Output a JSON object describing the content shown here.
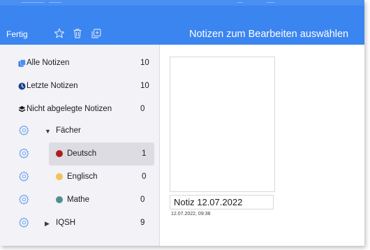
{
  "toolbar": {
    "done_label": "Fertig",
    "title": "Notizen zum Bearbeiten auswählen",
    "icons": [
      "star-icon",
      "trash-icon",
      "duplicate-icon"
    ],
    "accent_color": "#3b85f0"
  },
  "sidebar": {
    "items": [
      {
        "label": "Alle Notizen",
        "count": "10",
        "icon": "notes-stack-icon"
      },
      {
        "label": "Letzte Notizen",
        "count": "10",
        "icon": "clock-icon"
      },
      {
        "label": "Nicht abgelegte Notizen",
        "count": "0",
        "icon": "layers-icon"
      }
    ],
    "groups": [
      {
        "label": "Fächer",
        "expanded": true,
        "children": [
          {
            "label": "Deutsch",
            "count": "1",
            "color": "#b01c1c",
            "selected": true
          },
          {
            "label": "Englisch",
            "count": "0",
            "color": "#f4c257"
          },
          {
            "label": "Mathe",
            "count": "0",
            "color": "#4e8f95"
          }
        ]
      },
      {
        "label": "IQSH",
        "count": "9",
        "expanded": false
      }
    ]
  },
  "notes": [
    {
      "title": "Notiz 12.07.2022",
      "date": "12.07.2022, 09:38"
    }
  ]
}
